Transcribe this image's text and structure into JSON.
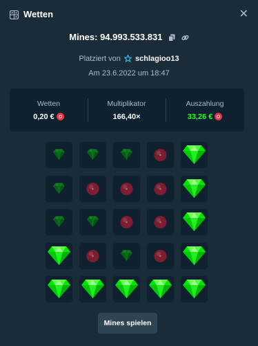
{
  "header": {
    "title": "Wetten",
    "icon": "bet-slip-icon",
    "close_icon": "close-icon",
    "close_glyph": "✕"
  },
  "bet": {
    "game_line": "Mines: 94.993.533.831",
    "placed_by_prefix": "Platziert von",
    "username": "schlagioo13",
    "date_line": "Am 23.6.2022 um 18:47"
  },
  "stats": {
    "wager_label": "Wetten",
    "wager_value": "0,20 €",
    "multiplier_label": "Multiplikator",
    "multiplier_value": "166,40×",
    "payout_label": "Auszahlung",
    "payout_value": "33,26 €",
    "currency_icon": "coin-icon"
  },
  "board": {
    "columns": 5,
    "legend": {
      "G": "revealed-gem",
      "g": "unrevealed-gem",
      "m": "unrevealed-mine"
    },
    "tiles": [
      "g",
      "g",
      "g",
      "m",
      "G",
      "g",
      "m",
      "m",
      "m",
      "G",
      "g",
      "g",
      "m",
      "m",
      "G",
      "G",
      "m",
      "g",
      "m",
      "G",
      "G",
      "G",
      "G",
      "G",
      "G"
    ]
  },
  "play_button": "Mines spielen",
  "colors": {
    "background": "#1a2c38",
    "panel": "#0f212e",
    "gem": "#00e701",
    "mine": "#e33548",
    "payout": "#1fff20",
    "muted": "#b1bad3"
  }
}
